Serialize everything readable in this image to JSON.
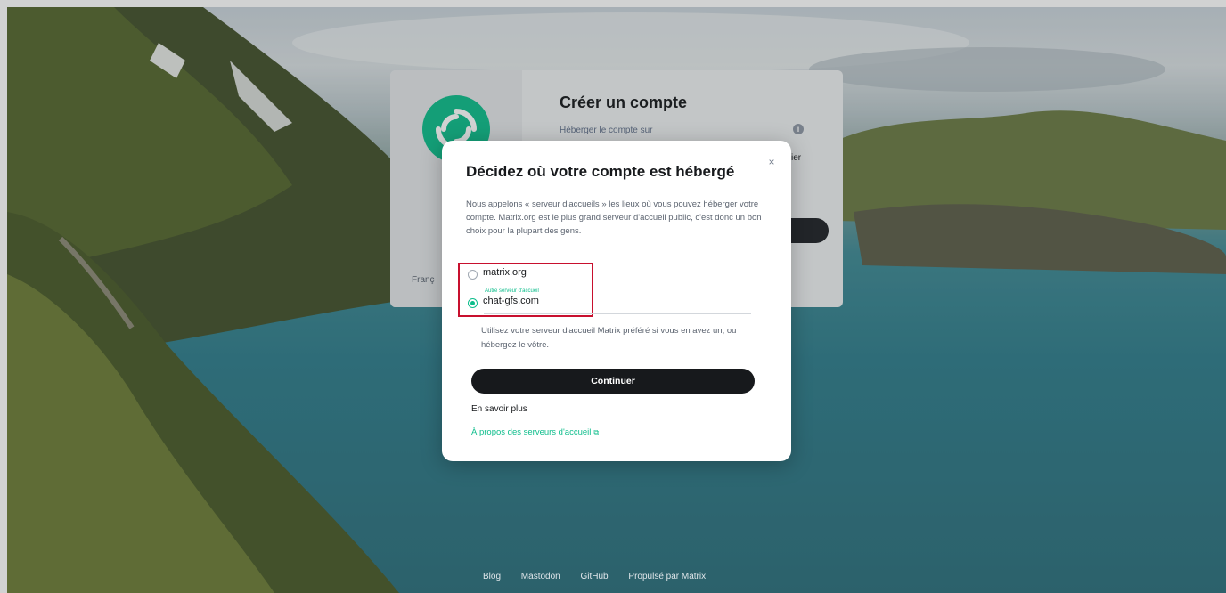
{
  "background_card": {
    "title": "Créer un compte",
    "subtitle": "Héberger le compte sur",
    "edit_label": "ier",
    "language": "Franç"
  },
  "modal": {
    "title": "Décidez où votre compte est hébergé",
    "close_label": "×",
    "description": "Nous appelons « serveur d'accueils » les lieux où vous pouvez héberger votre compte. Matrix.org est le plus grand serveur d'accueil public, c'est donc un bon choix pour la plupart des gens.",
    "options": [
      {
        "label": "matrix.org",
        "checked": false
      },
      {
        "field_label": "Autre serveur d'accueil",
        "label": "chat-gfs.com",
        "checked": true
      }
    ],
    "hint": "Utilisez votre serveur d'accueil Matrix préféré si vous en avez un, ou hébergez le vôtre.",
    "continue_label": "Continuer",
    "learn_more_heading": "En savoir plus",
    "about_link": "À propos des serveurs d'accueil",
    "about_link_icon": "external-link-icon"
  },
  "footer": {
    "links": [
      "Blog",
      "Mastodon",
      "GitHub",
      "Propulsé par Matrix"
    ]
  },
  "colors": {
    "accent": "#0dbd8b",
    "button_dark": "#17191c",
    "highlight": "#c8102e"
  }
}
